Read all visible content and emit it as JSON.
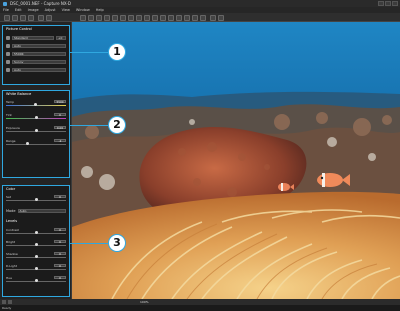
{
  "window": {
    "title": "DSC_0001.NEF - Capture NX-D"
  },
  "menu": [
    "File",
    "Edit",
    "Image",
    "Adjust",
    "View",
    "Window",
    "Help"
  ],
  "panel1": {
    "title": "Picture Control",
    "rows": [
      {
        "label": "Standard",
        "value": "+0"
      },
      {
        "label": "Auto",
        "value": ""
      },
      {
        "label": "5500K",
        "value": ""
      },
      {
        "label": "Sunny",
        "value": ""
      },
      {
        "label": "Auto",
        "value": ""
      }
    ]
  },
  "panel2": {
    "title": "White Balance",
    "rows": [
      {
        "label": "Temp",
        "value": "5500"
      },
      {
        "label": "Tint",
        "value": "0"
      },
      {
        "label": "Exposure",
        "value": "0.00"
      },
      {
        "label": "Range",
        "value": "-2"
      }
    ]
  },
  "panel3": {
    "title": "Color",
    "sub_title": "Levels",
    "rows": [
      {
        "label": "Sat",
        "value": "0"
      },
      {
        "label": "Mode",
        "value": "Auto"
      },
      {
        "label": "Contrast",
        "value": "0"
      },
      {
        "label": "Bright",
        "value": "0"
      },
      {
        "label": "Shadow",
        "value": "0"
      },
      {
        "label": "D-Light",
        "value": "0"
      },
      {
        "label": "Hue",
        "value": "0"
      }
    ]
  },
  "callouts": [
    "1",
    "2",
    "3"
  ],
  "bottombar": {
    "zoom": "100%"
  },
  "status": "Ready"
}
